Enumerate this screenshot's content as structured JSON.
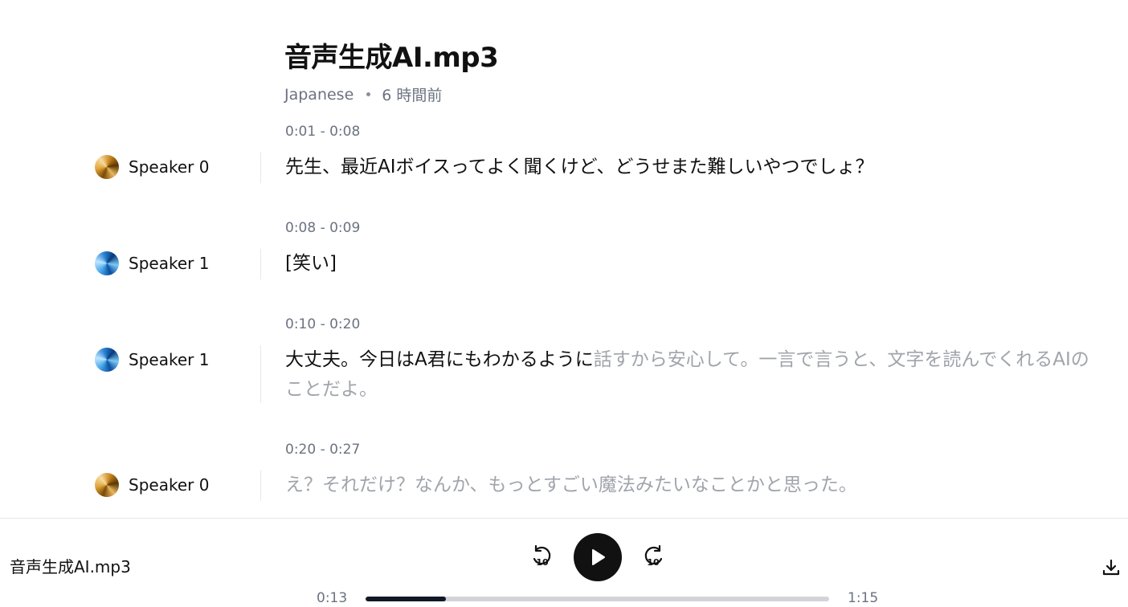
{
  "header": {
    "title": "音声生成AI.mp3",
    "language": "Japanese",
    "age": "6 時間前"
  },
  "segments": [
    {
      "time": "0:01 - 0:08",
      "speaker": "Speaker 0",
      "text_spoken": "先生、最近AIボイスってよく聞くけど、どうせまた難しいやつでしょ？",
      "text_current": "",
      "text_pending": ""
    },
    {
      "time": "0:08 - 0:09",
      "speaker": "Speaker 1",
      "text_spoken": "[笑い]",
      "text_current": "",
      "text_pending": ""
    },
    {
      "time": "0:10 - 0:20",
      "speaker": "Speaker 1",
      "text_spoken": "大丈夫。今日はA君にもわかるように",
      "text_current": "",
      "text_pending": "話すから安心して。一言で言うと、文字を読んでくれるAIのことだよ。"
    },
    {
      "time": "0:20 - 0:27",
      "speaker": "Speaker 0",
      "text_spoken": "",
      "text_current": "",
      "text_pending": "え？それだけ？なんか、もっとすごい魔法みたいなことかと思った。"
    }
  ],
  "player": {
    "file_name": "音声生成AI.mp3",
    "current_time": "0:13",
    "total_time": "1:15",
    "progress": 0.173,
    "rewind_label": "10",
    "forward_label": "10"
  }
}
